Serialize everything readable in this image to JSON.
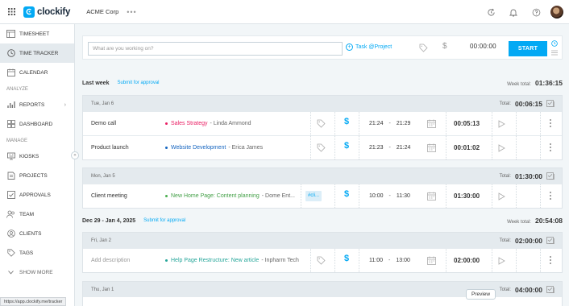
{
  "app": {
    "name": "clockify",
    "workspace": "ACME Corp",
    "workspace_menu": "•••"
  },
  "topbar": {
    "icons": [
      "apps-grid-icon",
      "timer-refresh-icon",
      "bell-icon",
      "help-icon",
      "avatar"
    ]
  },
  "sidebar": {
    "items": [
      {
        "label": "TIMESHEET",
        "icon": "timesheet-icon",
        "active": false
      },
      {
        "label": "TIME TRACKER",
        "icon": "clock-icon",
        "active": true
      },
      {
        "label": "CALENDAR",
        "icon": "calendar-icon",
        "active": false
      }
    ],
    "analyze_header": "ANALYZE",
    "analyze_items": [
      {
        "label": "REPORTS",
        "icon": "reports-icon",
        "has_submenu": true
      },
      {
        "label": "DASHBOARD",
        "icon": "dashboard-icon",
        "has_submenu": false
      }
    ],
    "manage_header": "MANAGE",
    "manage_items": [
      {
        "label": "KIOSKS",
        "icon": "kiosk-icon"
      },
      {
        "label": "PROJECTS",
        "icon": "projects-icon"
      },
      {
        "label": "APPROVALS",
        "icon": "approvals-icon"
      },
      {
        "label": "TEAM",
        "icon": "team-icon"
      },
      {
        "label": "CLIENTS",
        "icon": "clients-icon"
      },
      {
        "label": "TAGS",
        "icon": "tag-icon"
      }
    ],
    "show_more": "SHOW MORE",
    "collapse": "«"
  },
  "timer": {
    "placeholder": "What are you working on?",
    "project_label": "Task @Project",
    "billable_symbol": "$",
    "duration": "00:00:00",
    "start_label": "START"
  },
  "weeks": [
    {
      "title": "Last week",
      "submit_label": "Submit for approval",
      "total_label": "Week total:",
      "total": "01:36:15",
      "groups": [
        {
          "date": "Tue, Jan 6",
          "total_label": "Total:",
          "total": "00:06:15",
          "entries": [
            {
              "description": "Demo call",
              "project": "Sales Strategy",
              "project_color": "#e91e63",
              "client": "Linda Ammond",
              "start": "21:24",
              "end": "21:29",
              "duration": "00:05:13",
              "billable": true
            },
            {
              "description": "Product launch",
              "project": "Website Development",
              "project_color": "#1565c0",
              "client": "Erica James",
              "start": "21:23",
              "end": "21:24",
              "duration": "00:01:02",
              "billable": true
            }
          ]
        },
        {
          "date": "Mon, Jan 5",
          "total_label": "Total:",
          "total": "01:30:00",
          "entries": [
            {
              "description": "Client meeting",
              "project": "New Home Page: Content planning",
              "project_color": "#4caf50",
              "client": "Dome Ent...",
              "tag": "#cli...",
              "start": "10:00",
              "end": "11:30",
              "duration": "01:30:00",
              "billable": true
            }
          ]
        }
      ]
    },
    {
      "title": "Dec 29 - Jan 4, 2025",
      "submit_label": "Submit for approval",
      "total_label": "Week total:",
      "total": "20:54:08",
      "groups": [
        {
          "date": "Fri, Jan 2",
          "total_label": "Total:",
          "total": "02:00:00",
          "entries": [
            {
              "description": "Add description",
              "project": "Help Page Restructure: New article",
              "project_color": "#26a69a",
              "client": "Inpharm Tech",
              "start": "11:00",
              "end": "13:00",
              "duration": "02:00:00",
              "billable": true
            }
          ]
        },
        {
          "date": "Thu, Jan 1",
          "total_label": "Total:",
          "total": "04:00:00",
          "entries": []
        }
      ]
    }
  ],
  "status_url": "https://app.clockify.me/tracker",
  "preview_label": "Preview",
  "colors": {
    "accent": "#03a9f4",
    "sidebar_active": "#e4eaee",
    "background": "#f2f6f8"
  }
}
